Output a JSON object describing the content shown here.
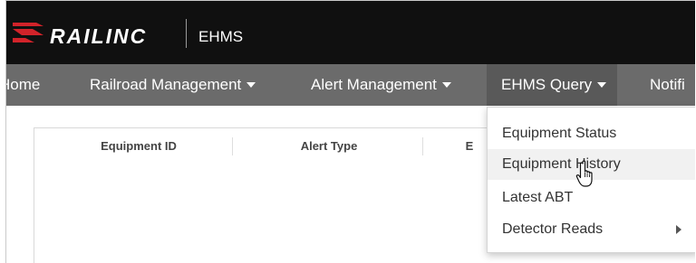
{
  "header": {
    "logo_text": "RAILINC",
    "app_name": "EHMS",
    "logo_icon": "railinc-logo-icon",
    "colors": {
      "topbar": "#101010",
      "logo_accent": "#d2232a",
      "navbar": "#6b6b6b"
    }
  },
  "nav": {
    "items": [
      {
        "label": "Home",
        "has_dropdown": false
      },
      {
        "label": "Railroad Management",
        "has_dropdown": true
      },
      {
        "label": "Alert Management",
        "has_dropdown": true
      },
      {
        "label": "EHMS Query",
        "has_dropdown": true,
        "active": true
      },
      {
        "label": "Notifi",
        "has_dropdown": false
      }
    ]
  },
  "table": {
    "columns": [
      "Equipment ID",
      "Alert Type",
      "E"
    ]
  },
  "dropdown": {
    "items": [
      {
        "label": "Equipment Status"
      },
      {
        "label": "Equipment History",
        "hovered": true
      },
      {
        "label": "Latest ABT"
      },
      {
        "label": "Detector Reads",
        "has_submenu": true
      }
    ]
  },
  "cursor": {
    "icon": "hand-pointer-icon"
  }
}
